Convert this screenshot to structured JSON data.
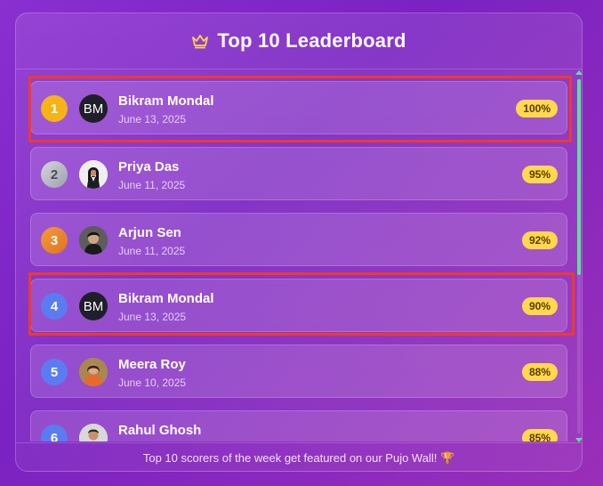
{
  "header": {
    "title": "Top 10 Leaderboard",
    "icon": "crown-icon"
  },
  "entries": [
    {
      "rank": "1",
      "name": "Bikram Mondal",
      "date": "June 13, 2025",
      "score": "100%",
      "avatar_initials": "BM",
      "rank_color": "#f5b316"
    },
    {
      "rank": "2",
      "name": "Priya Das",
      "date": "June 11, 2025",
      "score": "95%",
      "avatar_initials": "",
      "rank_color": "#b9bcc6"
    },
    {
      "rank": "3",
      "name": "Arjun Sen",
      "date": "June 11, 2025",
      "score": "92%",
      "avatar_initials": "",
      "rank_color": "#ef8a2c"
    },
    {
      "rank": "4",
      "name": "Bikram Mondal",
      "date": "June 13, 2025",
      "score": "90%",
      "avatar_initials": "BM",
      "rank_color": "#5b7cf0"
    },
    {
      "rank": "5",
      "name": "Meera Roy",
      "date": "June 10, 2025",
      "score": "88%",
      "avatar_initials": "",
      "rank_color": "#5b7cf0"
    },
    {
      "rank": "6",
      "name": "Rahul Ghosh",
      "date": "",
      "score": "85%",
      "avatar_initials": "",
      "rank_color": "#5b7cf0"
    }
  ],
  "footer": {
    "text": "Top 10 scorers of the week get featured on our Pujo Wall! 🏆"
  },
  "colors": {
    "highlight": "#f03a2a",
    "score_badge": "#ffd84d",
    "scroll_thumb": "#5fe09a"
  }
}
